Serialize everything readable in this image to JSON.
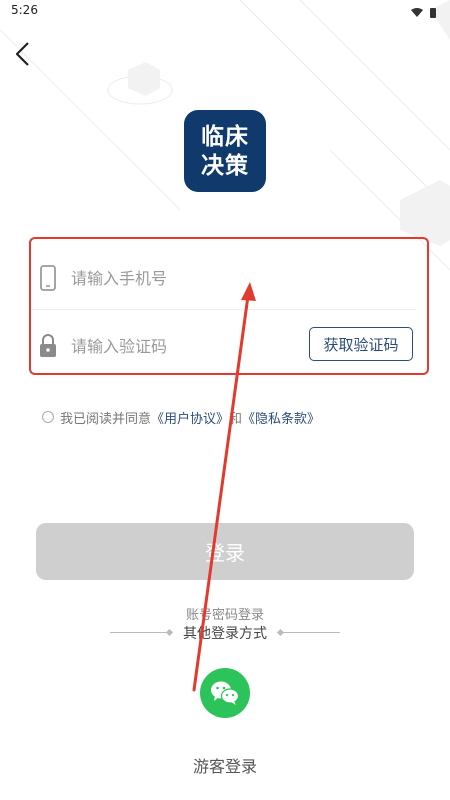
{
  "status_bar": {
    "time": "5:26"
  },
  "logo": {
    "line1": "临床",
    "line2": "决策"
  },
  "form": {
    "phone_placeholder": "请输入手机号",
    "code_placeholder": "请输入验证码",
    "get_code_label": "获取验证码"
  },
  "agreement": {
    "prefix": "我已阅读并同意",
    "user_agreement": "《用户协议》",
    "and": "和",
    "privacy_policy": "《隐私条款》"
  },
  "login_button": "登录",
  "account_password_login": "账号密码登录",
  "other_methods_label": "其他登录方式",
  "guest_login": "游客登录",
  "colors": {
    "brand": "#0f3a6b",
    "accent_link": "#2c4d7a",
    "highlight_red": "#e03b2e",
    "wechat_green": "#2cc35a",
    "disabled_button": "#cfcfcf"
  }
}
